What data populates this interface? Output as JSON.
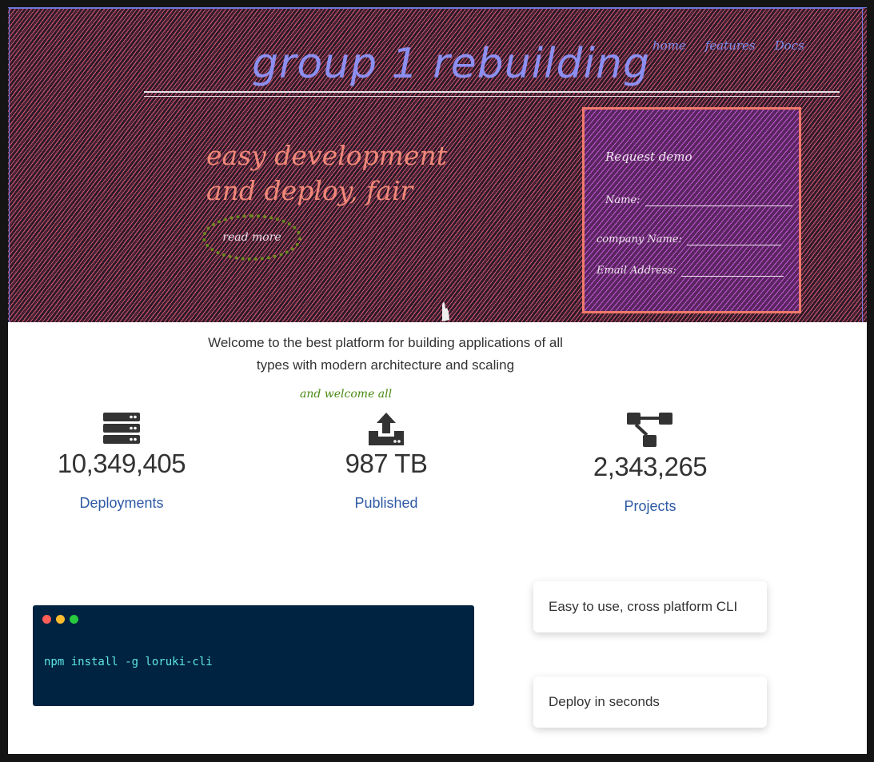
{
  "header": {
    "title": "group 1 rebuilding",
    "nav": [
      "home",
      "features",
      "Docs"
    ]
  },
  "hero": {
    "tagline": "easy development and deploy, fair",
    "read_more_label": "read more"
  },
  "demo_form": {
    "heading": "Request demo",
    "fields": [
      "Name:",
      "company Name:",
      "Email Address:"
    ]
  },
  "intro": {
    "text": "Welcome to the best platform for building applications of all types with modern architecture and scaling",
    "note": "and welcome all"
  },
  "stats": [
    {
      "icon": "server-icon",
      "value": "10,349,405",
      "label": "Deployments"
    },
    {
      "icon": "upload-icon",
      "value": "987 TB",
      "label": "Published"
    },
    {
      "icon": "project-tree-icon",
      "value": "2,343,265",
      "label": "Projects"
    }
  ],
  "terminal": {
    "command": "npm install -g loruki-cli",
    "dot_colors": [
      "#ff5f56",
      "#ffbd2e",
      "#27c93f"
    ]
  },
  "features": [
    "Easy to use, cross platform CLI",
    "Deploy in seconds"
  ],
  "colors": {
    "hero_bg": "#2c1a2a",
    "hatch": "#e86078",
    "title": "#8c8ff0",
    "demo_border": "#f07a6a",
    "link_blue": "#2e5aa4",
    "terminal_bg": "#002341"
  }
}
